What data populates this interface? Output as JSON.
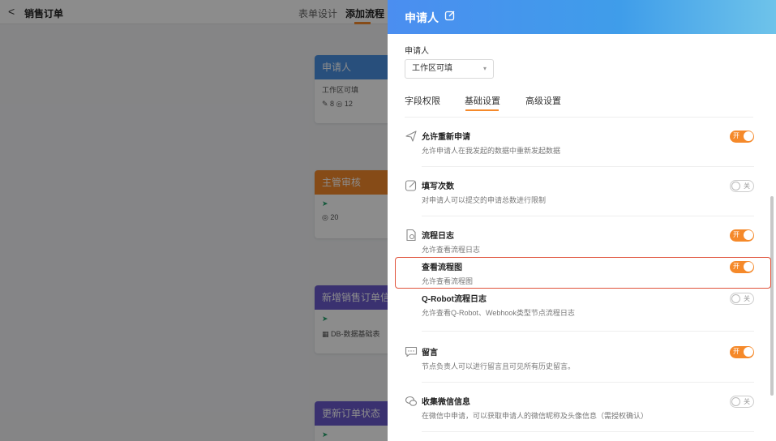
{
  "topbar": {
    "back": "<",
    "title": "销售订单",
    "tab_form": "表单设计",
    "tab_flow": "添加流程"
  },
  "nodes": [
    {
      "title": "申请人",
      "line1": "工作区可填",
      "line2": "✎ 8 ◎ 12"
    },
    {
      "title": "主管审核",
      "line1": "➤",
      "line2": "◎ 20"
    },
    {
      "title": "新增销售订单信息",
      "line1": "➤",
      "line2": "▦ DB-数据基础表"
    },
    {
      "title": "更新订单状态",
      "line1": "➤"
    }
  ],
  "drawer": {
    "title": "申请人",
    "applicant_label": "申请人",
    "select_value": "工作区可填",
    "tabs": [
      "字段权限",
      "基础设置",
      "高级设置"
    ],
    "active_tab": "基础设置",
    "items": [
      {
        "name": "允许重新申请",
        "desc": "允许申请人在我发起的数据中重新发起数据",
        "on": true,
        "icon": "send-icon"
      },
      {
        "name": "填写次数",
        "desc": "对申请人可以提交的申请总数进行限制",
        "on": false,
        "icon": "edit-icon"
      },
      {
        "name": "流程日志",
        "desc": "允许查看流程日志",
        "on": true,
        "icon": "log-icon"
      },
      {
        "name": "查看流程图",
        "desc": "允许查看流程图",
        "on": true,
        "icon": ""
      },
      {
        "name": "Q-Robot流程日志",
        "desc": "允许查看Q-Robot、Webhook类型节点流程日志",
        "on": false,
        "icon": ""
      },
      {
        "name": "留言",
        "desc": "节点负责人可以进行留言且可见所有历史留言。",
        "on": true,
        "icon": "comment-icon"
      },
      {
        "name": "收集微信信息",
        "desc": "在微信中申请，可以获取申请人的微信昵称及头像信息（需授权确认）",
        "on": false,
        "icon": "wechat-icon"
      }
    ],
    "toggle_on_text": "开",
    "toggle_off_text": "关"
  },
  "colors": {
    "accent": "#f5892a",
    "header_blue": "#4b8ef0",
    "highlight": "#e0533b"
  }
}
